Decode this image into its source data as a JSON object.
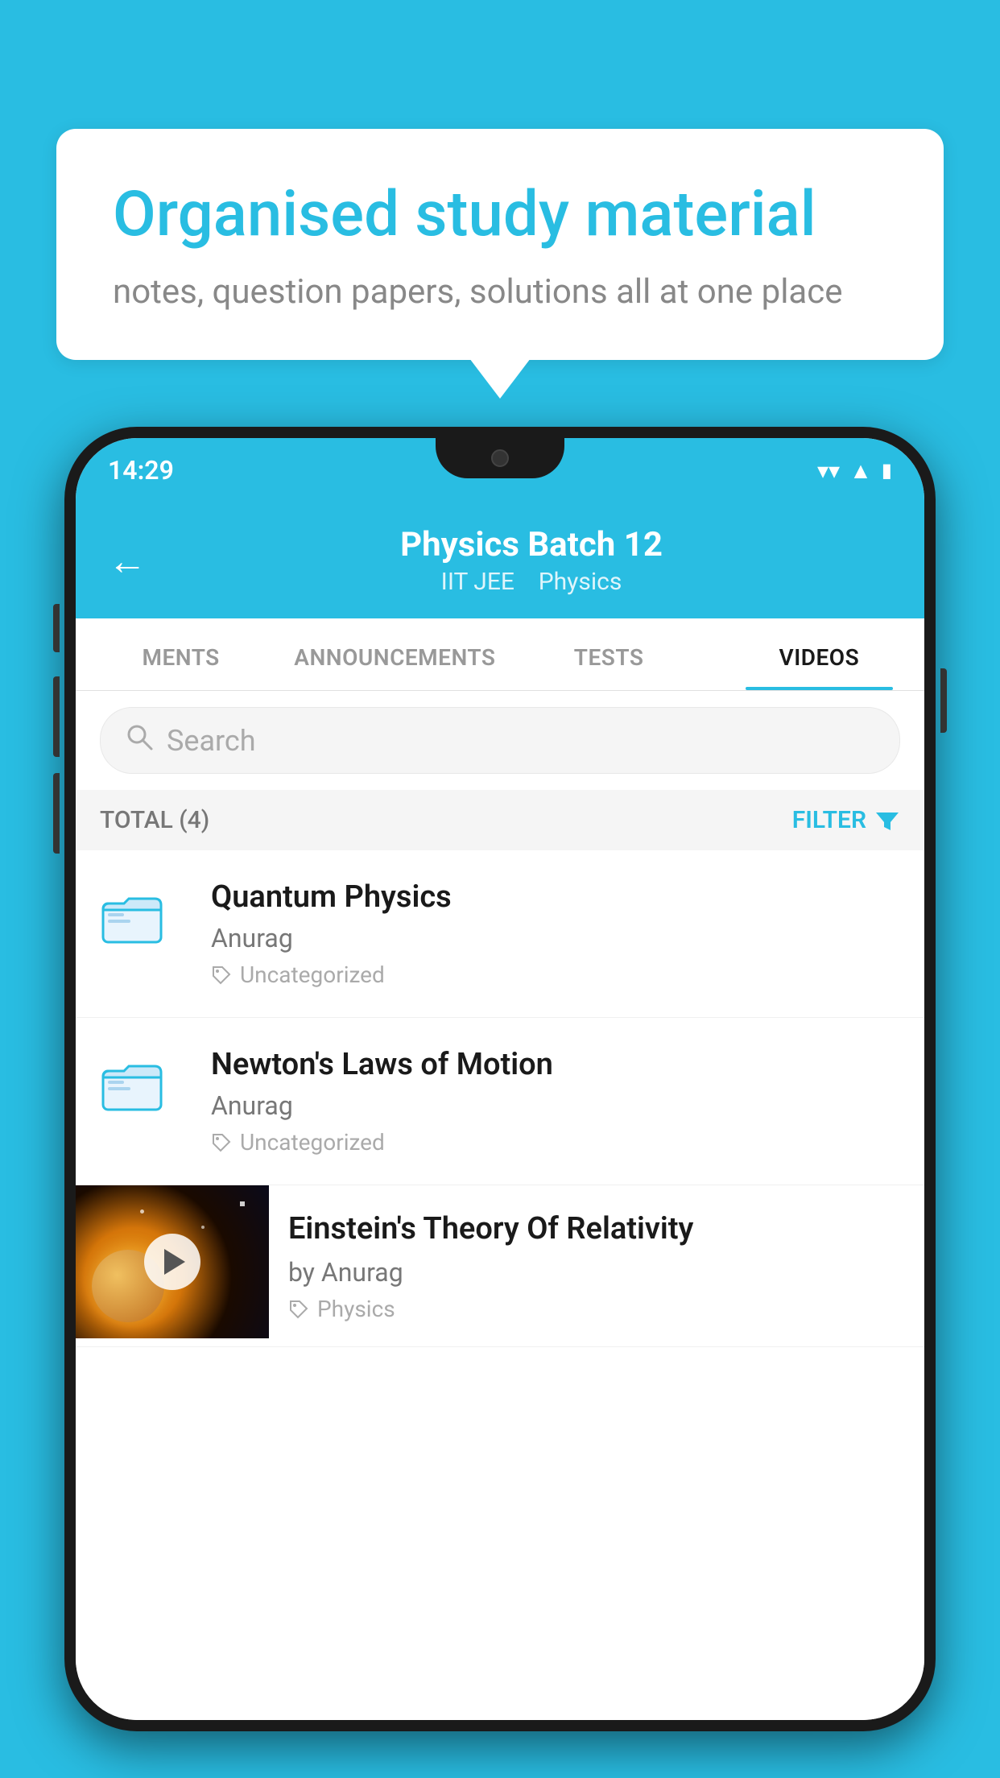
{
  "background_color": "#29bde2",
  "speech_bubble": {
    "title": "Organised study material",
    "subtitle": "notes, question papers, solutions all at one place"
  },
  "phone": {
    "status_bar": {
      "time": "14:29",
      "wifi": "▼",
      "signal": "▲",
      "battery": "▮"
    },
    "header": {
      "back_label": "←",
      "title": "Physics Batch 12",
      "subtitle_part1": "IIT JEE",
      "subtitle_part2": "Physics"
    },
    "tabs": [
      {
        "id": "ments",
        "label": "MENTS",
        "active": false
      },
      {
        "id": "announcements",
        "label": "ANNOUNCEMENTS",
        "active": false
      },
      {
        "id": "tests",
        "label": "TESTS",
        "active": false
      },
      {
        "id": "videos",
        "label": "VIDEOS",
        "active": true
      }
    ],
    "search": {
      "placeholder": "Search"
    },
    "filter_bar": {
      "total_label": "TOTAL (4)",
      "filter_label": "FILTER"
    },
    "items": [
      {
        "id": "quantum-physics",
        "title": "Quantum Physics",
        "author": "Anurag",
        "tag": "Uncategorized",
        "has_thumbnail": false
      },
      {
        "id": "newtons-laws",
        "title": "Newton's Laws of Motion",
        "author": "Anurag",
        "tag": "Uncategorized",
        "has_thumbnail": false
      },
      {
        "id": "einsteins-theory",
        "title": "Einstein's Theory Of Relativity",
        "author": "by Anurag",
        "tag": "Physics",
        "has_thumbnail": true
      }
    ]
  }
}
